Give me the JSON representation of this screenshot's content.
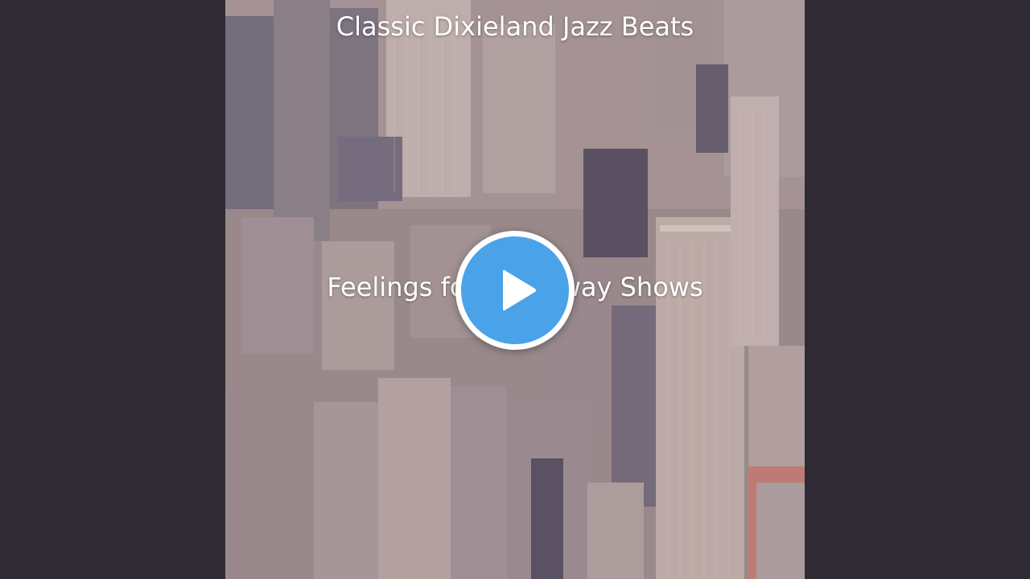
{
  "video": {
    "album_title": "Classic Dixieland Jazz Beats",
    "track_title": "Feelings for Broadway Shows",
    "artwork_icon": "city-skyline-artwork",
    "play_icon": "play-icon"
  },
  "colors": {
    "background": "#2f2b35",
    "play_accent": "#4aa3e8",
    "title_text": "#ffffff"
  }
}
